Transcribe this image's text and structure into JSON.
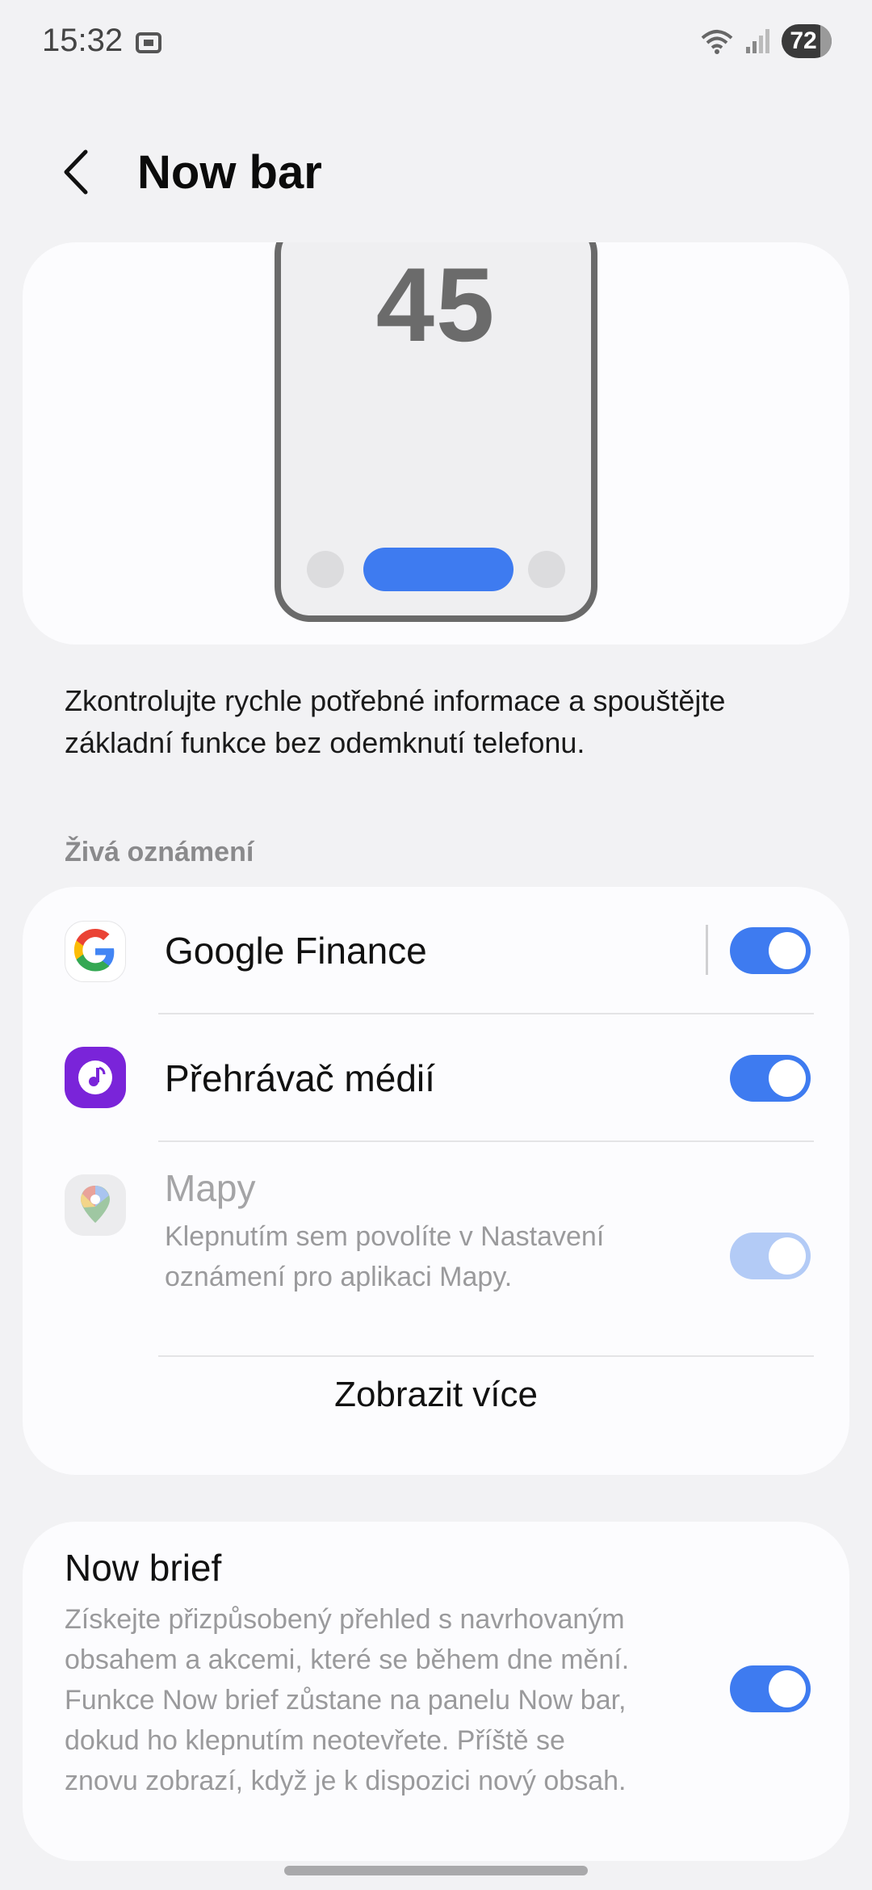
{
  "status_bar": {
    "time": "15:32",
    "battery": "72",
    "icons": [
      "screenshot-icon",
      "wifi-icon",
      "signal-icon",
      "battery-icon"
    ]
  },
  "header": {
    "title": "Now bar",
    "back_icon": "back-arrow-icon"
  },
  "preview": {
    "clock": "45",
    "accent": "#3e7bf0"
  },
  "description": "Zkontrolujte rychle potřebné informace a spouštějte základní funkce bez odemknutí telefonu.",
  "live_notifications": {
    "section_label": "Živá oznámení",
    "items": [
      {
        "name": "Google Finance",
        "icon": "google-icon",
        "enabled": true
      },
      {
        "name": "Přehrávač médií",
        "icon": "music-player-icon",
        "enabled": true
      },
      {
        "name": "Mapy",
        "icon": "maps-icon",
        "subtitle": "Klepnutím sem povolíte v Nastavení oznámení pro aplikaci Mapy.",
        "enabled": true,
        "disabled": true
      }
    ],
    "show_more": "Zobrazit více"
  },
  "now_brief": {
    "title": "Now brief",
    "description": "Získejte přizpůsobený přehled s navrhovaným obsahem a akcemi, které se během dne mění. Funkce Now brief zůstane na panelu Now bar, dokud ho klepnutím neotevřete. Příště se znovu zobrazí, když je k dispozici nový obsah.",
    "enabled": true
  }
}
